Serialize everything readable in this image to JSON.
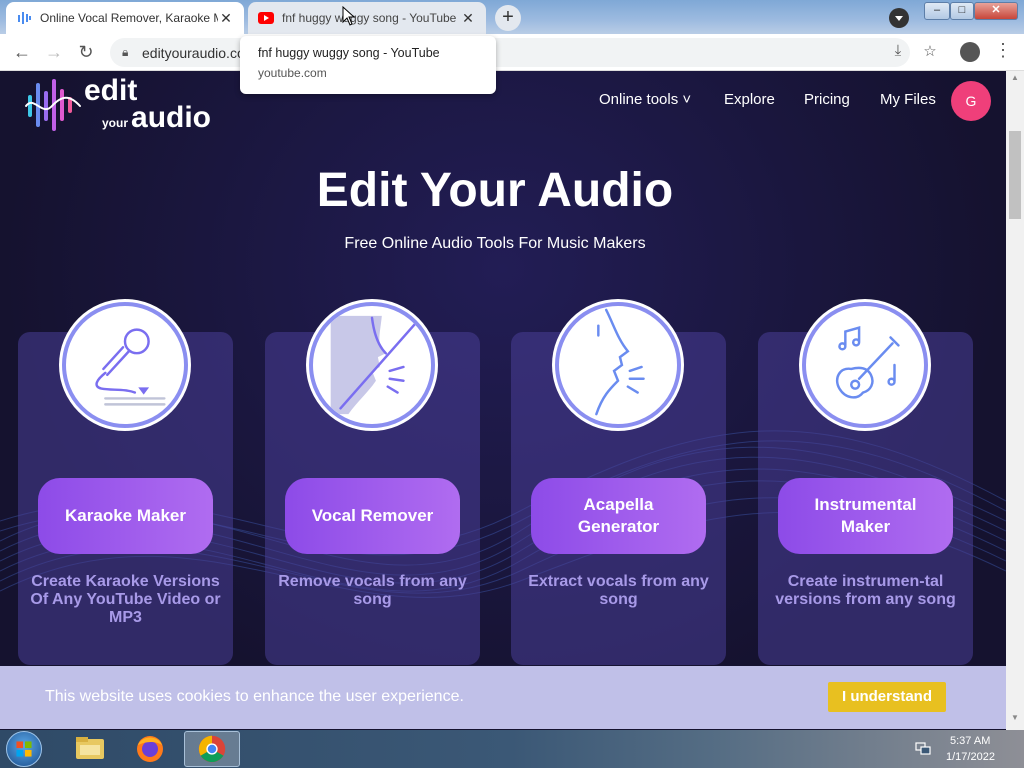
{
  "browser": {
    "tabs": [
      {
        "title": "Online Vocal Remover, Karaoke M",
        "favicon": "edityouraudio-favicon",
        "active": true
      },
      {
        "title": "fnf huggy wuggy song - YouTube",
        "favicon": "youtube-favicon",
        "active": false
      }
    ],
    "new_tab_label": "+",
    "url": "edityouraudio.co",
    "tooltip": {
      "title": "fnf huggy wuggy song - YouTube",
      "domain": "youtube.com"
    },
    "window_buttons": {
      "minimize": "–",
      "maximize": "□",
      "close": "✕"
    }
  },
  "site": {
    "logo": {
      "line1": "edit",
      "line2_small": "your",
      "line2_big": "audio"
    },
    "nav": {
      "online_tools": "Online tools ˅",
      "explore": "Explore",
      "pricing": "Pricing",
      "my_files": "My Files"
    },
    "avatar_letter": "G",
    "hero": {
      "title": "Edit Your Audio",
      "subtitle": "Free Online Audio Tools For Music Makers"
    },
    "cards": [
      {
        "button": "Karaoke Maker",
        "description": "Create Karaoke Versions Of Any YouTube Video or MP3",
        "icon": "microphone-icon"
      },
      {
        "button": "Vocal Remover",
        "description": "Remove vocals from any song",
        "icon": "muted-singer-icon"
      },
      {
        "button": "Acapella Generator",
        "description": "Extract vocals from any song",
        "icon": "singer-icon"
      },
      {
        "button": "Instrumental Maker",
        "description": "Create instrumen-tal versions from any song",
        "icon": "guitar-icon"
      }
    ],
    "cookie": {
      "text": "This website uses cookies to enhance the user experience.",
      "button": "I understand"
    }
  },
  "taskbar": {
    "time": "5:37 AM",
    "date": "1/17/2022",
    "apps": [
      "windows-explorer",
      "firefox",
      "chrome"
    ]
  },
  "colors": {
    "accent_purple": "#9b59f0",
    "avatar_pink": "#ef3f7a",
    "cookie_button": "#e8c020",
    "page_bg": "#1b1840"
  }
}
